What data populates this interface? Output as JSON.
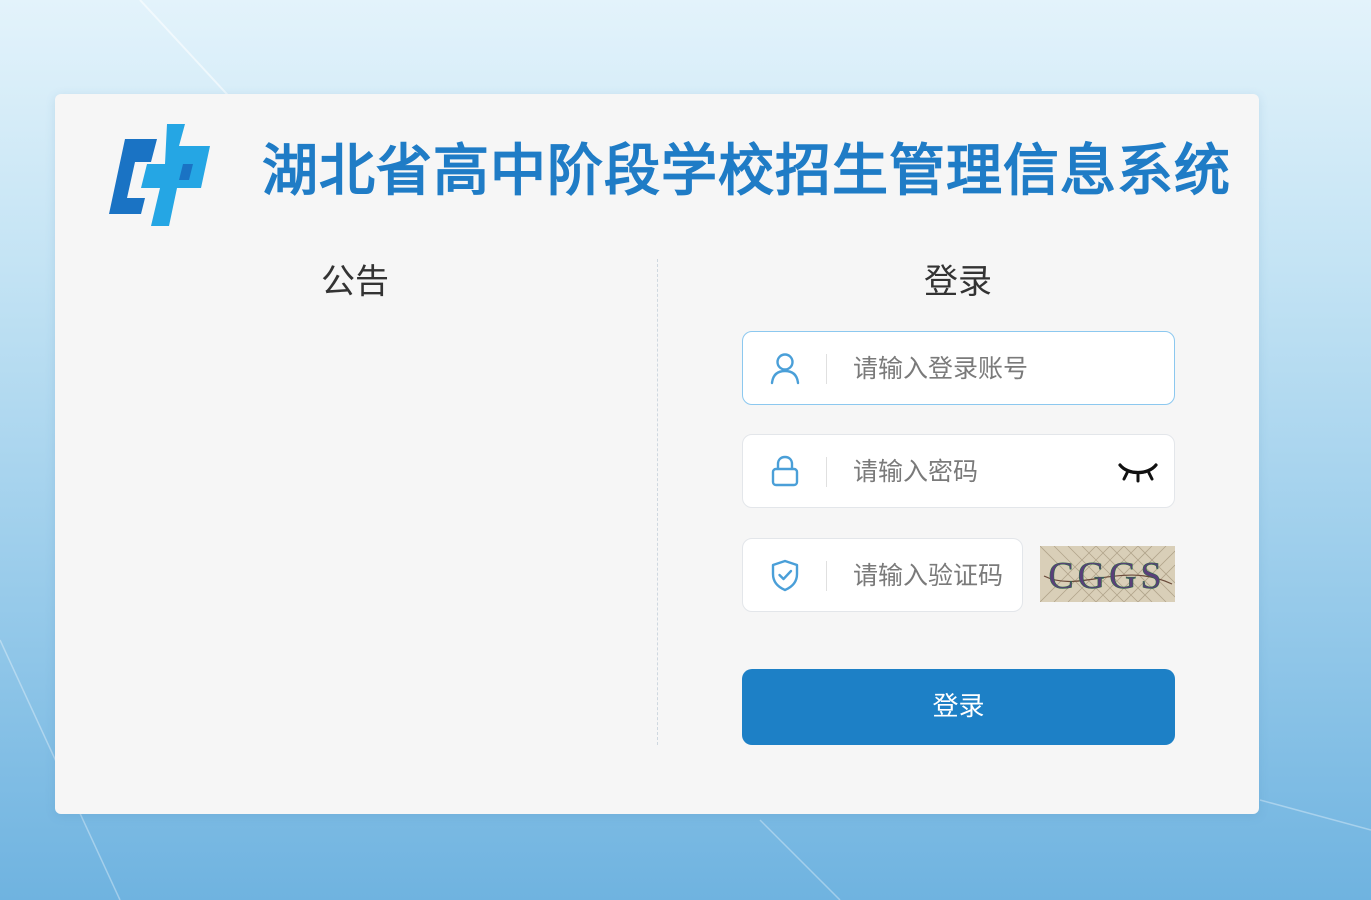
{
  "header": {
    "title": "湖北省高中阶段学校招生管理信息系统",
    "logo_icon": "hubei-exam-logo-icon"
  },
  "notice": {
    "heading": "公告"
  },
  "login": {
    "heading": "登录",
    "account_placeholder": "请输入登录账号",
    "password_placeholder": "请输入密码",
    "captcha_placeholder": "请输入验证码",
    "captcha_text": "CGGS",
    "submit_label": "登录"
  },
  "colors": {
    "brand": "#1f7cc6",
    "button": "#1d80c6",
    "icon": "#4a9fd8"
  }
}
